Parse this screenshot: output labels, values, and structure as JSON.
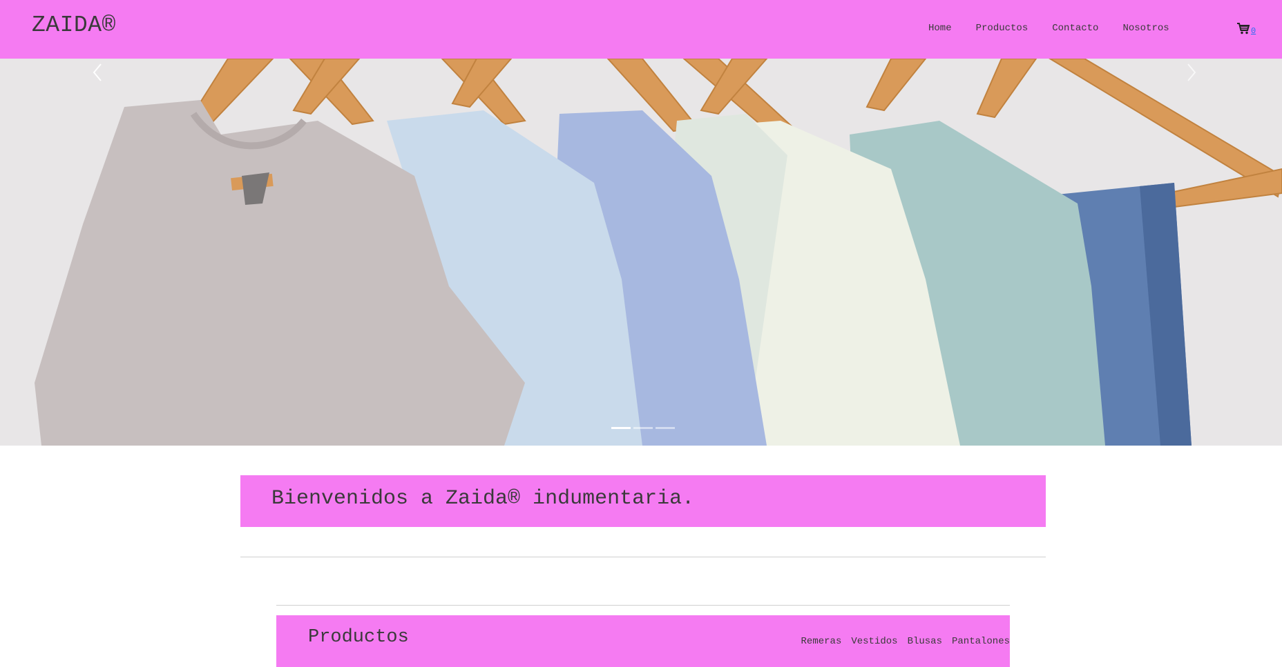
{
  "navbar": {
    "brand": "ZAIDA®",
    "links": [
      "Home",
      "Productos",
      "Contacto",
      "Nosotros"
    ],
    "cart_icon": "cart-icon",
    "cart_count": "0"
  },
  "hero": {
    "image": "hanging-tshirts-photo",
    "prev_icon": "chevron-left-icon",
    "next_icon": "chevron-right-icon",
    "slide_count": 3,
    "active_slide": 1
  },
  "welcome": {
    "title": "Bienvenidos a Zaida® indumentaria."
  },
  "products": {
    "title": "Productos",
    "categories": [
      "Remeras",
      "Vestidos",
      "Blusas",
      "Pantalones"
    ]
  },
  "colors": {
    "accent": "#f57bf2",
    "text": "#3a3a3a",
    "link": "#2a6cf0"
  }
}
